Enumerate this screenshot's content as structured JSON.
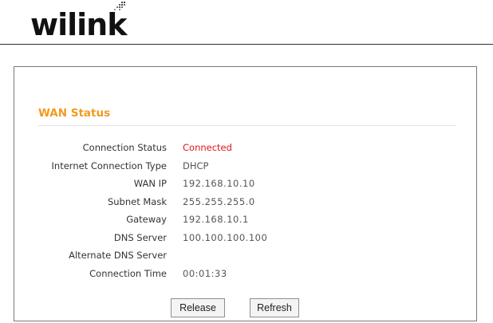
{
  "header": {
    "logo_text": "wilink"
  },
  "wan_status": {
    "title": "WAN Status",
    "rows": [
      {
        "label": "Connection Status",
        "value": "Connected"
      },
      {
        "label": "Internet Connection Type",
        "value": "DHCP"
      },
      {
        "label": "WAN IP",
        "value": "192.168.10.10"
      },
      {
        "label": "Subnet Mask",
        "value": "255.255.255.0"
      },
      {
        "label": "Gateway",
        "value": "192.168.10.1"
      },
      {
        "label": "DNS Server",
        "value": "100.100.100.100"
      },
      {
        "label": "Alternate DNS Server",
        "value": ""
      },
      {
        "label": "Connection Time",
        "value": "00:01:33"
      }
    ]
  },
  "buttons": {
    "release_label": "Release",
    "refresh_label": "Refresh"
  },
  "colors": {
    "title_orange": "#f39a1e",
    "connected_red": "#e0151d",
    "text_gray": "#555555"
  }
}
